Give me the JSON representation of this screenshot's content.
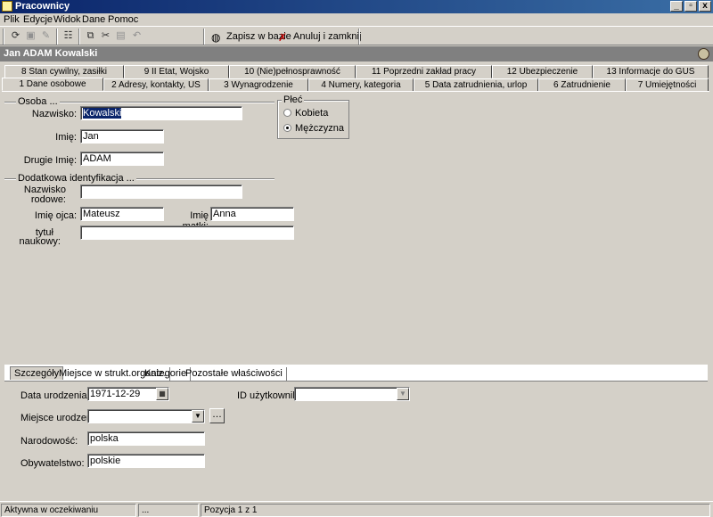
{
  "window": {
    "title": "Pracownicy",
    "buttons": [
      "_",
      "▫",
      "x"
    ]
  },
  "menu": [
    {
      "label": "Plik"
    },
    {
      "label": "Edycje"
    },
    {
      "label": "Widok"
    },
    {
      "label": "Dane"
    },
    {
      "label": "Pomoc"
    }
  ],
  "toolbar": {
    "save_label": "Zapisz w bazie",
    "cancel_label": "Anuluj i zamknij"
  },
  "record": {
    "title": "Jan ADAM Kowalski"
  },
  "tabs_row1": [
    "8 Stan cywilny, zasiłki",
    "9 II Etat, Wojsko",
    "10 (Nie)pełnosprawność",
    "11 Poprzedni zakład pracy",
    "12 Ubezpieczenie",
    "13 Informacje do GUS"
  ],
  "tabs_row2": [
    "1 Dane osobowe",
    "2 Adresy, kontakty, US",
    "3 Wynagrodzenie",
    "4 Numery, kategoria",
    "5 Data zatrudnienia, urlop",
    "6 Zatrudnienie",
    "7 Umiejętności"
  ],
  "osoba": {
    "group_title": "Osoba ...",
    "nazwisko_label": "Nazwisko:",
    "nazwisko_value": "Kowalski",
    "imie_label": "Imię:",
    "imie_value": "Jan",
    "drugie_imie_label": "Drugie Imię:",
    "drugie_imie_value": "ADAM"
  },
  "plec": {
    "group_title": "Płeć",
    "kobieta_label": "Kobieta",
    "mezczyzna_label": "Mężczyzna",
    "selected": "Mężczyzna"
  },
  "dodatkowa": {
    "group_title": "Dodatkowa identyfikacja ...",
    "nazwisko_rodowe_label_1": "Nazwisko",
    "nazwisko_rodowe_label_2": "rodowe:",
    "nazwisko_rodowe_value": "",
    "imie_ojca_label": "Imię ojca:",
    "imie_ojca_value": "Mateusz",
    "imie_matki_label": "Imię matki:",
    "imie_matki_value": "Anna",
    "tytul_label_1": "tytuł",
    "tytul_label_2": "naukowy:",
    "tytul_value": ""
  },
  "subtabs": [
    "Szczegóły",
    "Miejsce w strukt.organiz.",
    "Kategorie",
    "Pozostałe właściwości"
  ],
  "details": {
    "data_urodzenia_label": "Data urodzenia:",
    "data_urodzenia_value": "1971-12-29",
    "miejsce_urodzenia_label": "Miejsce urodzenia:",
    "miejsce_urodzenia_value": "",
    "narodowosc_label": "Narodowość:",
    "narodowosc_value": "polska",
    "obywatelstwo_label": "Obywatelstwo:",
    "obywatelstwo_value": "polskie",
    "id_uzytkownika_label": "ID użytkownika:",
    "id_uzytkownika_value": ""
  },
  "status": {
    "state": "Aktywna w oczekiwaniu",
    "middle": "...",
    "position": "Pozycja 1 z 1"
  }
}
